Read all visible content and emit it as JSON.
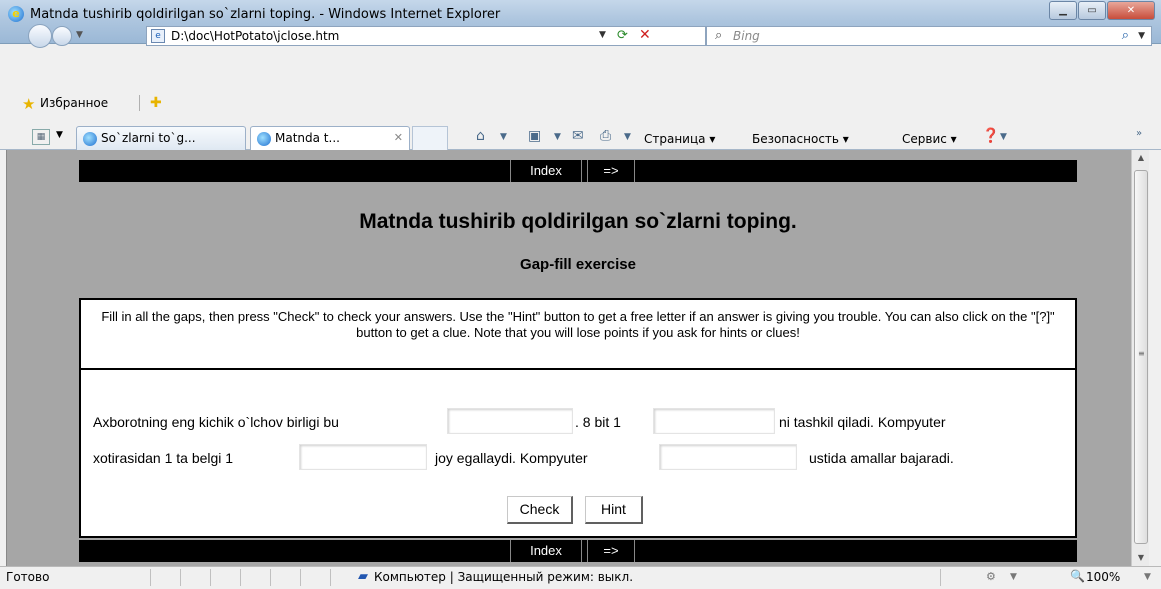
{
  "window": {
    "title": "Matnda tushirib qoldirilgan so`zlarni toping. - Windows Internet Explorer",
    "icon": "ie-icon"
  },
  "toolbar": {
    "address": "D:\\doc\\HotPotato\\jclose.htm",
    "search_placeholder": "Bing"
  },
  "favorites": {
    "label": "Избранное"
  },
  "tabs": [
    {
      "label": "So`zlarni to`g..."
    },
    {
      "label": "Matnda t..."
    }
  ],
  "commands": {
    "page": "Страница ▾",
    "safety": "Безопасность ▾",
    "tools": "Сервис ▾"
  },
  "page": {
    "nav": {
      "index": "Index",
      "next": "=>"
    },
    "title": "Matnda tushirib qoldirilgan so`zlarni toping.",
    "subtitle": "Gap-fill exercise",
    "instructions": "Fill in all the gaps, then press \"Check\" to check your answers. Use the \"Hint\" button to get a free letter if an answer is giving you trouble. You can also click on the \"[?]\" button to get a clue. Note that you will lose points if you ask for hints or clues!",
    "text": {
      "part1": "Axborotning eng kichik o`lchov birligi bu",
      "part2": ". 8 bit 1",
      "part3": "ni tashkil qiladi. Kompyuter",
      "part4": "xotirasidan 1 ta belgi 1",
      "part5": "joy egallaydi. Kompyuter",
      "part6": "ustida amallar bajaradi."
    },
    "gaps": [
      "",
      "",
      "",
      ""
    ],
    "buttons": {
      "check": "Check",
      "hint": "Hint"
    }
  },
  "status": {
    "left": "Готово",
    "zone": "Компьютер | Защищенный режим: выкл.",
    "zoom": "100%"
  }
}
